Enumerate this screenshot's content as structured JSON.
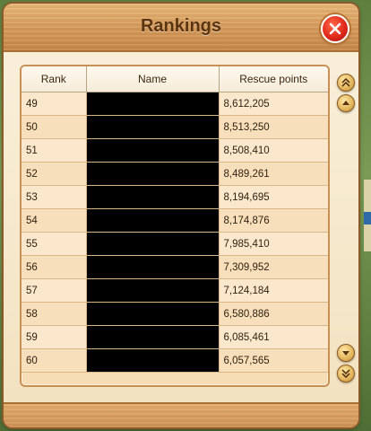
{
  "dialog": {
    "title": "Rankings",
    "close_icon": "close-icon"
  },
  "table": {
    "headers": {
      "rank": "Rank",
      "name": "Name",
      "points": "Rescue points"
    },
    "rows": [
      {
        "rank": "49",
        "points": "8,612,205"
      },
      {
        "rank": "50",
        "points": "8,513,250"
      },
      {
        "rank": "51",
        "points": "8,508,410"
      },
      {
        "rank": "52",
        "points": "8,489,261"
      },
      {
        "rank": "53",
        "points": "8,194,695"
      },
      {
        "rank": "54",
        "points": "8,174,876"
      },
      {
        "rank": "55",
        "points": "7,985,410"
      },
      {
        "rank": "56",
        "points": "7,309,952"
      },
      {
        "rank": "57",
        "points": "7,124,184"
      },
      {
        "rank": "58",
        "points": "6,580,886"
      },
      {
        "rank": "59",
        "points": "6,085,461"
      },
      {
        "rank": "60",
        "points": "6,057,565"
      }
    ]
  },
  "scroll_controls": {
    "top_icon": "double-chevron-up-icon",
    "up_icon": "chevron-up-icon",
    "down_icon": "chevron-down-icon",
    "bottom_icon": "double-chevron-down-icon"
  },
  "colors": {
    "close": "#e0291c",
    "title_text": "#5b3410",
    "redacted": "#000000"
  }
}
